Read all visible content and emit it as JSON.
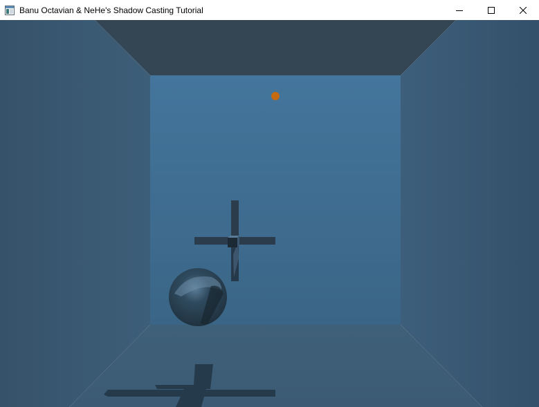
{
  "window": {
    "title": "Banu Octavian & NeHe's Shadow Casting Tutorial",
    "icon": "app-window-icon",
    "controls": {
      "minimize": "minimize-icon",
      "maximize": "maximize-icon",
      "close": "close-icon"
    }
  },
  "scene": {
    "colors": {
      "ceiling": "#344554",
      "back_wall": "#3e6a8e",
      "left_wall": "#3a5870",
      "right_wall": "#3b5a72",
      "floor": "#3f5d77",
      "light": "#c46a10",
      "cross": "#2b3d4c",
      "sphere": "#2a3d4d",
      "shadow": "#253a4a"
    }
  }
}
